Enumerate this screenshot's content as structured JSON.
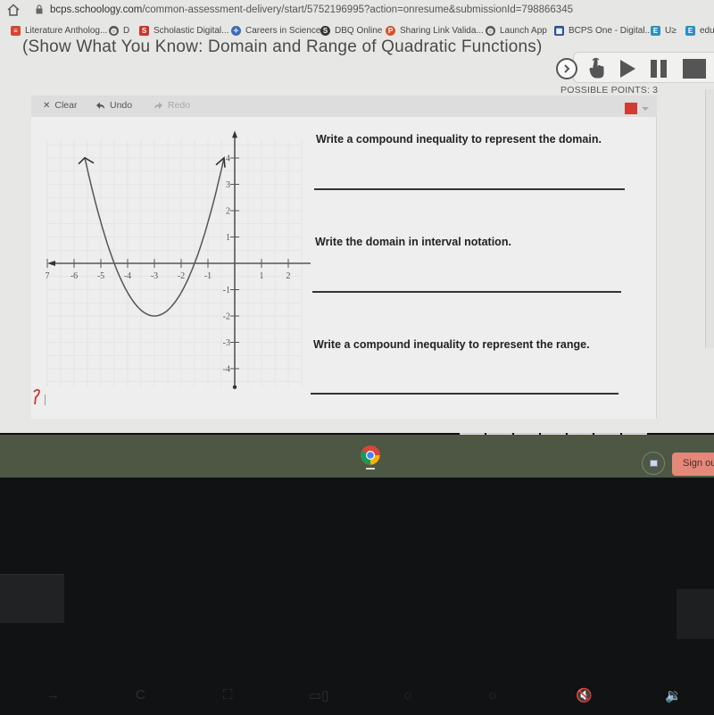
{
  "browser": {
    "url_host": "bcps.schoology.com",
    "url_path": "/common-assessment-delivery/start/5752196995?action=onresume&submissionId=798866345",
    "bookmarks": [
      {
        "label": "Literature Antholog...",
        "icon": "literature-icon",
        "color": "#d9432f"
      },
      {
        "label": "D",
        "icon": "globe-icon",
        "color": "#555555"
      },
      {
        "label": "Scholastic Digital...",
        "icon": "scholastic-icon",
        "color": "#d2312b"
      },
      {
        "label": "Careers in Science",
        "icon": "careers-icon",
        "color": "#3d6ab0"
      },
      {
        "label": "DBQ Online",
        "icon": "dbq-icon",
        "color": "#333333"
      },
      {
        "label": "Sharing Link Valida...",
        "icon": "powerpoint-icon",
        "color": "#d2542f"
      },
      {
        "label": "Launch App",
        "icon": "globe-icon",
        "color": "#555555"
      },
      {
        "label": "BCPS One - Digital...",
        "icon": "bcps-icon",
        "color": "#2f4e9e"
      },
      {
        "label": "U≥",
        "icon": "e-icon",
        "color": "#2a8fc9"
      },
      {
        "label": "edu",
        "icon": "e-icon",
        "color": "#2a8fc9"
      }
    ]
  },
  "assessment": {
    "title": "(Show What You Know: Domain and Range of Quadratic Functions)",
    "possible_points": "POSSIBLE POINTS: 3"
  },
  "toolbar": {
    "clear_label": "Clear",
    "undo_label": "Undo",
    "redo_label": "Redo",
    "pen_color": "#d23a32"
  },
  "questions": [
    {
      "prompt": "Write a compound inequality to represent the domain.",
      "answer": ""
    },
    {
      "prompt": "Write the domain in interval notation.",
      "answer": ""
    },
    {
      "prompt": "Write a compound inequality to represent the range.",
      "answer": ""
    }
  ],
  "chart_data": {
    "type": "line",
    "title": "",
    "xlabel": "",
    "ylabel": "",
    "function": "y = (8/9)(x + 3)^2 - 2",
    "vertex": [
      -3,
      -2
    ],
    "x_intercepts": [
      -4.5,
      -1.5
    ],
    "opens": "up",
    "arrows_at_ends": true,
    "xlim": [
      -7,
      2.5
    ],
    "ylim": [
      -4.7,
      4.7
    ],
    "x_ticks": [
      -7,
      -6,
      -5,
      -4,
      -3,
      -2,
      -1,
      1,
      2
    ],
    "x_tick_labels": [
      "7",
      "-6",
      "-5",
      "-4",
      "-3",
      "-2",
      "-1",
      "1",
      "2"
    ],
    "y_ticks": [
      -4,
      -3,
      -2,
      -1,
      1,
      2,
      3,
      4
    ],
    "y_tick_labels": [
      "-4",
      "-3",
      "-2",
      "-1",
      "1",
      "2",
      "3",
      "4"
    ],
    "grid": true,
    "points": [
      {
        "x": -5.6,
        "y": 4.0
      },
      {
        "x": -4.5,
        "y": 0
      },
      {
        "x": -3,
        "y": -2
      },
      {
        "x": -1.5,
        "y": 0
      },
      {
        "x": -0.4,
        "y": 4.0
      }
    ]
  },
  "taskbar": {
    "signout_label": "Sign out",
    "apps": [
      {
        "name": "Chrome"
      }
    ]
  },
  "keyboard": {
    "fn_keys": [
      "→",
      "C",
      "⛶",
      "▭▯",
      "☼",
      "☼",
      "🔇",
      "🔉"
    ]
  }
}
